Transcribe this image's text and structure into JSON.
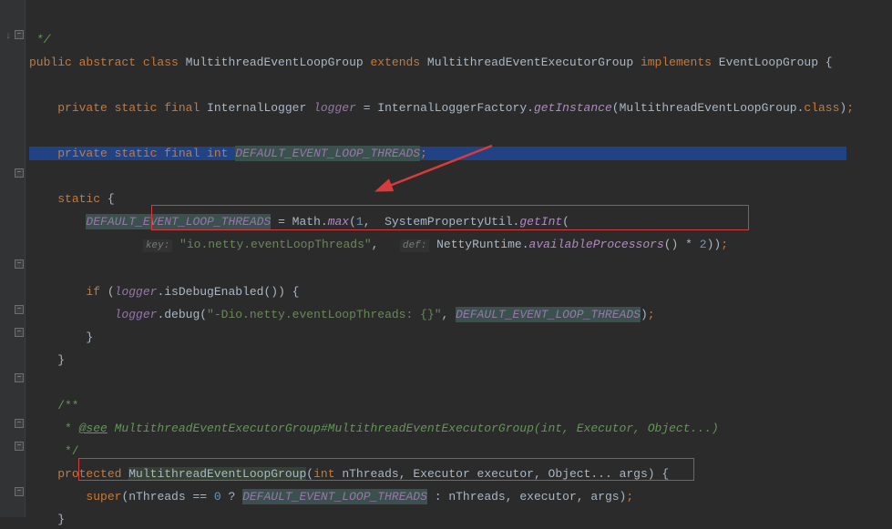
{
  "line1_cmt": " */",
  "line2": {
    "kw1": "public abstract class ",
    "cls1": "MultithreadEventLoopGroup ",
    "kw2": "extends ",
    "cls2": "MultithreadEventExecutorGroup ",
    "kw3": "implements ",
    "cls3": "EventLoopGroup {"
  },
  "line4": {
    "kw": "private static final ",
    "type": "InternalLogger ",
    "field": "logger",
    "eq": " = InternalLoggerFactory.",
    "mtd": "getInstance",
    "arg": "(MultithreadEventLoopGroup.",
    "kw2": "class",
    "end": ")",
    "semi": ";"
  },
  "line6": {
    "kw": "private static final int ",
    "field": "DEFAULT_EVENT_LOOP_THREADS",
    "semi": ";"
  },
  "line8": {
    "kw": "static",
    "brace": " {"
  },
  "line9": {
    "field": "DEFAULT_EVENT_LOOP_THREADS",
    "eq": " = Math.",
    "mtd": "max",
    "p1": "(",
    "n1": "1",
    "c1": ",  SystemPropertyUtil.",
    "mtd2": "getInt",
    "p2": "("
  },
  "line10": {
    "hint1": "key:",
    "str1": " \"io.netty.eventLoopThreads\"",
    "c1": ",   ",
    "hint2": "def:",
    "txt": " NettyRuntime.",
    "mtd": "availableProcessors",
    "p": "() * ",
    "n": "2",
    "end": "))",
    "semi": ";"
  },
  "line12": {
    "kw": "if ",
    "p1": "(",
    "field": "logger",
    "txt": ".isDebugEnabled()) {"
  },
  "line13": {
    "field": "logger",
    "txt": ".debug(",
    "str": "\"-Dio.netty.eventLoopThreads: {}\"",
    "c": ", ",
    "field2": "DEFAULT_EVENT_LOOP_THREADS",
    "p": ")",
    "semi": ";"
  },
  "line14": "        }",
  "line15": "    }",
  "line17": "    /**",
  "line18": {
    "pre": "     * ",
    "see": "@see",
    "link": " MultithreadEventExecutorGroup#MultithreadEventExecutorGroup(int, Executor, Object...)"
  },
  "line19": "     */",
  "line20": {
    "kw": "protected ",
    "name": "MultithreadEventLoopGroup",
    "p": "(",
    "kw2": "int ",
    "a1": "nThreads",
    "c1": ", Executor executor, Object... args) {"
  },
  "line21": {
    "kw": "super",
    "p1": "(nThreads == ",
    "n1": "0",
    "q": " ? ",
    "field": "DEFAULT_EVENT_LOOP_THREADS",
    "rest": " : nThreads, executor, args)",
    "semi": ";"
  },
  "line22": "    }"
}
